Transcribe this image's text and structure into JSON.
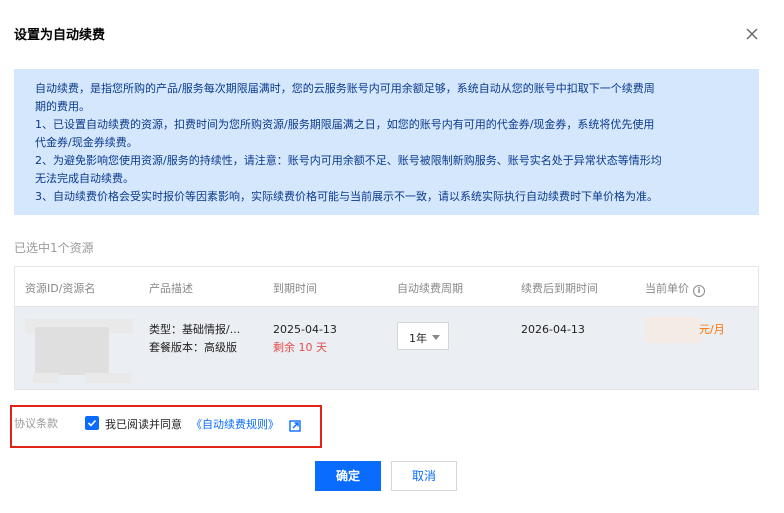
{
  "dialog": {
    "title": "设置为自动续费"
  },
  "notice": {
    "lines": [
      "自动续费，是指您所购的产品/服务每次期限届满时，您的云服务账号内可用余额足够，系统自动从您的账号中扣取下一个续费周",
      "期的费用。",
      "1、已设置自动续费的资源，扣费时间为您所购资源/服务期限届满之日，如您的账号内有可用的代金券/现金券，系统将优先使用",
      "代金券/现金券续费。",
      "2、为避免影响您使用资源/服务的持续性，请注意：账号内可用余额不足、账号被限制新购服务、账号实名处于异常状态等情形均",
      "无法完成自动续费。",
      "3、自动续费价格会受实时报价等因素影响，实际续费价格可能与当前展示不一致，请以系统实际执行自动续费时下单价格为准。"
    ]
  },
  "selection": {
    "label": "已选中1个资源"
  },
  "table": {
    "headers": [
      "资源ID/资源名",
      "产品描述",
      "到期时间",
      "自动续费周期",
      "续费后到期时间",
      "当前单价"
    ],
    "row": {
      "product_type": "类型：基础情报/...",
      "product_plan": "套餐版本：高级版",
      "expire_date": "2025-04-13",
      "remaining": "剩余 10 天",
      "period": "1年",
      "new_expire_date": "2026-04-13",
      "price_unit": "元/月"
    }
  },
  "agreement": {
    "label": "协议条款",
    "checked": true,
    "text": "我已阅读并同意",
    "link": "《自动续费规则》"
  },
  "buttons": {
    "confirm": "确定",
    "cancel": "取消"
  },
  "colors": {
    "primary": "#0a6cff",
    "notice_bg": "#d5e7fd",
    "warning": "#e34d4d",
    "price": "#ff7200",
    "highlight_border": "#e2231a"
  },
  "icons": {
    "close": "close-icon",
    "info": "info-icon",
    "caret": "caret-down-icon",
    "check": "check-icon",
    "external": "external-link-icon"
  }
}
